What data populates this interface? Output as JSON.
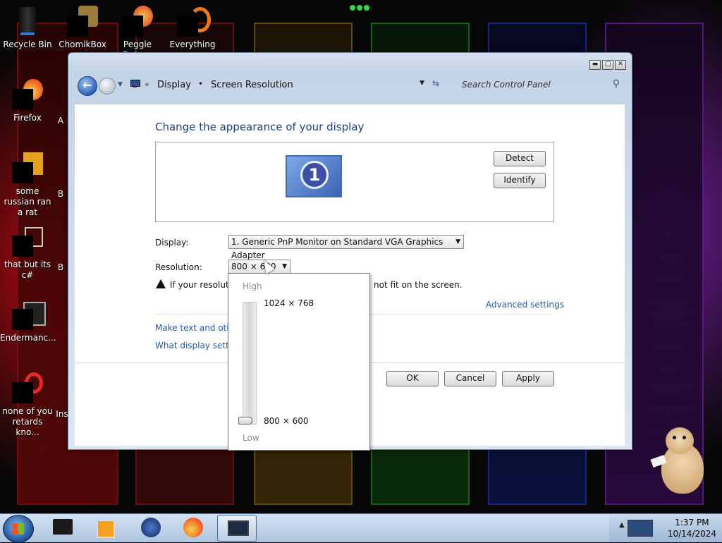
{
  "desktop": {
    "icons": [
      {
        "label": "Recycle Bin"
      },
      {
        "label": "ChomikBox"
      },
      {
        "label": "Peggle Deluxe"
      },
      {
        "label": "Everything"
      },
      {
        "label": "Firefox"
      },
      {
        "label": "some russian ran a rat"
      },
      {
        "label": "that but its c#"
      },
      {
        "label": "Endermanc..."
      },
      {
        "label": "none of you retards kno..."
      }
    ],
    "partial_labels": [
      "A",
      "B",
      "B",
      "Ins"
    ]
  },
  "window": {
    "breadcrumb": [
      "Display",
      "Screen Resolution"
    ],
    "search_placeholder": "Search Control Panel",
    "heading": "Change the appearance of your display",
    "monitor_number": "1",
    "detect_label": "Detect",
    "identify_label": "Identify",
    "display_label": "Display:",
    "display_value": "1. Generic PnP Monitor on Standard VGA Graphics Adapter",
    "resolution_label": "Resolution:",
    "resolution_value": "800 × 600",
    "warning_text_start": "If your resolutio",
    "warning_text_end": "not fit on the screen.",
    "advanced_link": "Advanced settings",
    "link_text_size": "Make text and other",
    "link_display_settings": "What display setting",
    "ok_label": "OK",
    "cancel_label": "Cancel",
    "apply_label": "Apply"
  },
  "resolution_dropdown": {
    "high_label": "High",
    "low_label": "Low",
    "options": [
      "1024 × 768",
      "800 × 600"
    ],
    "selected_index": 1,
    "slider_level_fraction": 0.0
  },
  "taskbar": {
    "clock_time": "1:37 PM",
    "clock_date": "10/14/2024"
  },
  "colors": {
    "heading": "#1f3f7a",
    "link": "#1f5ba8",
    "taskbar": "#c3d6ec"
  }
}
